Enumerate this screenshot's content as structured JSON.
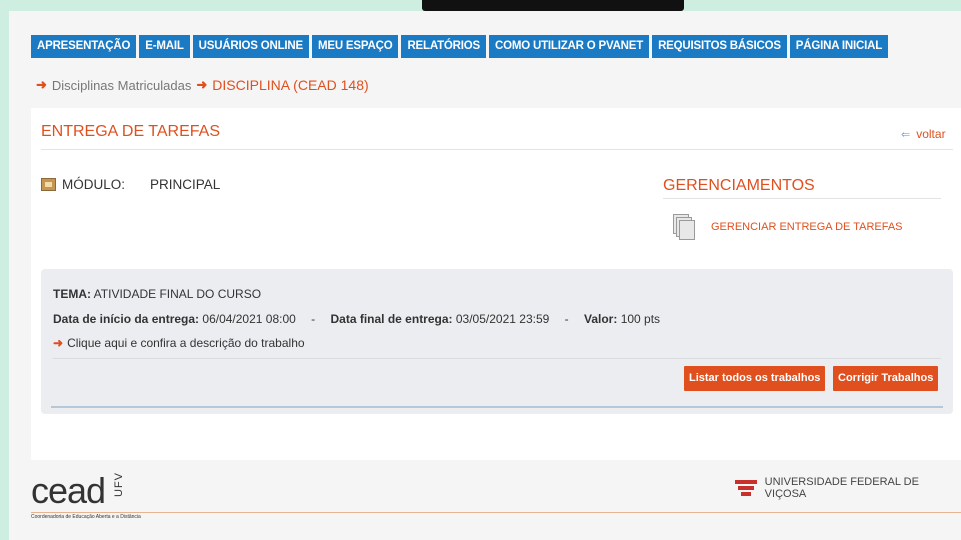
{
  "nav": {
    "items": [
      "APRESENTAÇÃO",
      "E-MAIL",
      "USUÁRIOS ONLINE",
      "MEU ESPAÇO",
      "RELATÓRIOS",
      "COMO UTILIZAR O PVANET",
      "REQUISITOS BÁSICOS",
      "PÁGINA INICIAL"
    ]
  },
  "breadcrumb": {
    "parent": "Disciplinas Matriculadas",
    "current": "DISCIPLINA (CEAD 148)"
  },
  "panel": {
    "title": "ENTREGA DE TAREFAS",
    "back_label": "voltar",
    "modulo_label": "MÓDULO:",
    "modulo_value": "PRINCIPAL"
  },
  "gerenciamentos": {
    "title": "GERENCIAMENTOS",
    "item_label": "GERENCIAR ENTREGA DE TAREFAS"
  },
  "task": {
    "tema_label": "TEMA:",
    "tema_value": "ATIVIDADE FINAL DO CURSO",
    "inicio_label": "Data de início da entrega:",
    "inicio_value": "06/04/2021 08:00",
    "final_label": "Data final de entrega:",
    "final_value": "03/05/2021 23:59",
    "valor_label": "Valor:",
    "valor_value": "100 pts",
    "separator": "-",
    "link_label": "Clique aqui e confira a descrição do trabalho",
    "btn_listar": "Listar todos os trabalhos",
    "btn_corrigir": "Corrigir Trabalhos"
  },
  "footer": {
    "logo_text": "cead",
    "logo_ufv": "UFV",
    "logo_subtitle": "Coordenadoria de Educação Aberta e a Distância",
    "university": "UNIVERSIDADE FEDERAL DE VIÇOSA"
  },
  "colors": {
    "nav_blue": "#1b7ac4",
    "accent_orange": "#e0501f"
  },
  "icons": {
    "breadcrumb_arrow": "right-arrow-icon",
    "back": "back-arrow-icon",
    "modulo": "box-icon",
    "gerenciar": "documents-icon",
    "crest": "university-crest-icon"
  }
}
